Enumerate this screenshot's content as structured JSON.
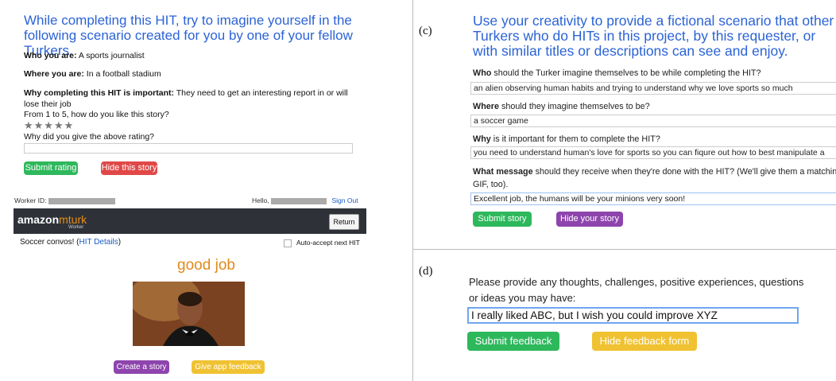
{
  "panel_a": {
    "intro": "While completing this HIT, try to imagine yourself in the following scenario created for you by one of your fellow Turkers.",
    "who_label": "Who you are:",
    "who_value": " A sports journalist",
    "where_label": "Where you are:",
    "where_value": " In a football stadium",
    "why_label": "Why completing this HIT is important:",
    "why_value": " They need to get an interesting report in or will lose their job",
    "rating_question": "From 1 to 5, how do you like this story?",
    "stars": "★★★★★",
    "reason_question": "Why did you give the above rating?",
    "submit_button": "Submit rating",
    "hide_button": "Hide this story",
    "worker_id_label": "Worker ID:",
    "hello_label": "Hello,",
    "sign_out": "Sign Out",
    "logo_amazon": "amazon",
    "logo_mturk": "mturk",
    "logo_worker": "Worker",
    "return_button": "Return",
    "hit_title": "Soccer convos! (",
    "hit_details_link": "HIT Details",
    "hit_close": ")",
    "auto_accept": "Auto-accept next HIT"
  },
  "panel_b": {
    "good_job": "good job",
    "create_story_button": "Create a story",
    "feedback_button": "Give app feedback"
  },
  "panel_c": {
    "label": "(c)",
    "title": "Use your creativity to provide a fictional scenario that other Turkers who do HITs in this project, by this requester, or with similar titles or descriptions can see and enjoy.",
    "q1_bold": "Who",
    "q1_rest": " should the Turker imagine themselves to be while completing the HIT?",
    "a1": "an alien observing human habits and trying to understand why we love sports so much",
    "q2_bold": "Where",
    "q2_rest": " should they imagine themselves to be?",
    "a2": "a soccer game",
    "q3_bold": "Why",
    "q3_rest": " is it important for them to complete the HIT?",
    "a3": "you need to understand human's love for sports so you can fiqure out how to best manipulate a",
    "q4_bold": "What message",
    "q4_rest": " should they receive when they're done with the HIT? (We'll give them a matching",
    "q4_rest2": "GIF, too).",
    "a4": "Excellent job, the humans will be your minions very soon!",
    "submit_button": "Submit story",
    "hide_button": "Hide your story"
  },
  "panel_d": {
    "label": "(d)",
    "prompt": "Please provide any thoughts, challenges, positive experiences, questions or ideas you may have:",
    "field_value": "I really liked ABC, but I wish you could improve XYZ",
    "submit_button": "Submit feedback",
    "hide_button": "Hide feedback form"
  },
  "colors": {
    "heading_blue": "#2b63d6",
    "green": "#2eb85c",
    "red": "#e04848",
    "purple": "#8e44ad",
    "yellow": "#f0c232",
    "orange": "#e08a1c",
    "mturk_bar": "#2e3238"
  }
}
